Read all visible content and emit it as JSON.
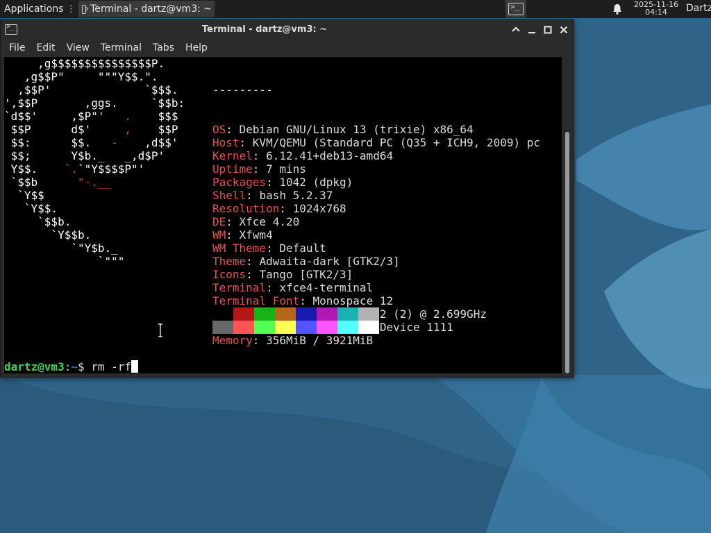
{
  "panel": {
    "apps_label": "Applications",
    "task_title": "Terminal - dartz@vm3: ~",
    "clock_date": "2025-11-16",
    "clock_time": "04:14",
    "user_name": "Dartz",
    "icons": {
      "apps": "xfce-logo-icon",
      "task": "terminal-icon",
      "launcher": "terminal-icon",
      "notifications": "bell-icon"
    }
  },
  "window": {
    "title": "Terminal - dartz@vm3: ~",
    "menu": [
      "File",
      "Edit",
      "View",
      "Terminal",
      "Tabs",
      "Help"
    ],
    "controls": {
      "up": "chevron-up-icon",
      "min": "minimize-icon",
      "max": "maximize-icon",
      "close": "close-icon"
    }
  },
  "terminal": {
    "ascii_lines": [
      [
        {
          "t": "     ,g$$$$$$$$$$$$$$$P."
        }
      ],
      [
        {
          "t": "   ,g$$P\"     \"\"\"Y$$.\"."
        }
      ],
      [
        {
          "t": "  ,$$P'              `$$$."
        }
      ],
      [
        {
          "t": "',$$P       ,ggs.     `$$b:"
        }
      ],
      [
        {
          "t": "`d$$'     ,$P\"'   "
        },
        {
          "t": ".",
          "c": "red"
        },
        {
          "t": "    $$$"
        }
      ],
      [
        {
          "t": " $$P      d$'     "
        },
        {
          "t": ",",
          "c": "red"
        },
        {
          "t": "    $$P"
        }
      ],
      [
        {
          "t": " $$:      $$.   "
        },
        {
          "t": "-",
          "c": "red"
        },
        {
          "t": "    ,d$$'"
        }
      ],
      [
        {
          "t": " $$;      Y$b._   _,d$P'"
        }
      ],
      [
        {
          "t": " Y$$.    "
        },
        {
          "t": "`.",
          "c": "red"
        },
        {
          "t": "`\"Y$$$$P\"'"
        }
      ],
      [
        {
          "t": " `$$b      "
        },
        {
          "t": "\"-.__",
          "c": "red"
        }
      ],
      [
        {
          "t": "  `Y$$"
        }
      ],
      [
        {
          "t": "   `Y$$."
        }
      ],
      [
        {
          "t": "     `$$b."
        }
      ],
      [
        {
          "t": "       `Y$$b."
        }
      ],
      [
        {
          "t": "          `\"Y$b._"
        }
      ],
      [
        {
          "t": "              `\"\"\""
        }
      ]
    ],
    "header_dashes": "---------",
    "info": [
      {
        "key": "OS",
        "value": "Debian GNU/Linux 13 (trixie) x86_64"
      },
      {
        "key": "Host",
        "value": "KVM/QEMU (Standard PC (Q35 + ICH9, 2009) pc"
      },
      {
        "key": "Kernel",
        "value": "6.12.41+deb13-amd64"
      },
      {
        "key": "Uptime",
        "value": "7 mins"
      },
      {
        "key": "Packages",
        "value": "1042 (dpkg)"
      },
      {
        "key": "Shell",
        "value": "bash 5.2.37"
      },
      {
        "key": "Resolution",
        "value": "1024x768"
      },
      {
        "key": "DE",
        "value": "Xfce 4.20"
      },
      {
        "key": "WM",
        "value": "Xfwm4"
      },
      {
        "key": "WM Theme",
        "value": "Default"
      },
      {
        "key": "Theme",
        "value": "Adwaita-dark [GTK2/3]"
      },
      {
        "key": "Icons",
        "value": "Tango [GTK2/3]"
      },
      {
        "key": "Terminal",
        "value": "xfce4-terminal"
      },
      {
        "key": "Terminal Font",
        "value": "Monospace 12"
      },
      {
        "key": "CPU",
        "value": "Intel Xeon E5-2697 v2 (2) @ 2.699GHz"
      },
      {
        "key": "GPU",
        "value": "00:03.0 Vendor 1234 Device 1111"
      },
      {
        "key": "Memory",
        "value": "356MiB / 3921MiB"
      }
    ],
    "palette_normal": [
      "#000000",
      "#b21818",
      "#18b218",
      "#b26818",
      "#1818b2",
      "#b218b2",
      "#18b2b2",
      "#b2b2b2"
    ],
    "palette_bright": [
      "#686868",
      "#ff5454",
      "#54ff54",
      "#ffff54",
      "#5454ff",
      "#ff54ff",
      "#54ffff",
      "#ffffff"
    ],
    "prompt": {
      "user_host": "dartz@vm3",
      "colon": ":",
      "path": "~",
      "symbol": "$ ",
      "command": "rm -rf"
    }
  },
  "colors": {
    "key_red": "#e85050",
    "prompt_green": "#37d74d",
    "prompt_blue": "#3f6ae8",
    "wallpaper": "#3a6f93"
  }
}
